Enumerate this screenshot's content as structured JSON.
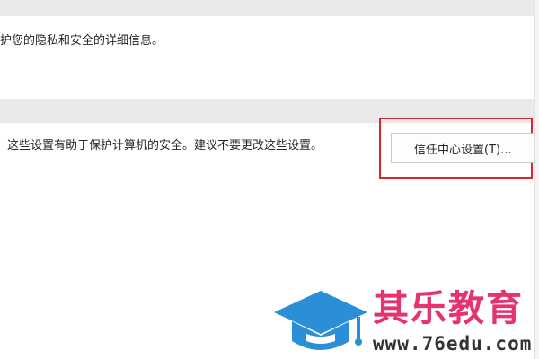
{
  "privacy_section": {
    "text": "护您的隐私和安全的详细信息。"
  },
  "trust_center_section": {
    "description": "这些设置有助于保护计算机的安全。建议不要更改这些设置。",
    "button_label": "信任中心设置(T)..."
  },
  "watermark": {
    "name": "其乐教育",
    "url": "www.76edu.com"
  },
  "colors": {
    "highlight": "#d7262c",
    "band": "#e9e9e9",
    "watermark_name": "#e5336d",
    "watermark_cap": "#2a8fd6"
  }
}
